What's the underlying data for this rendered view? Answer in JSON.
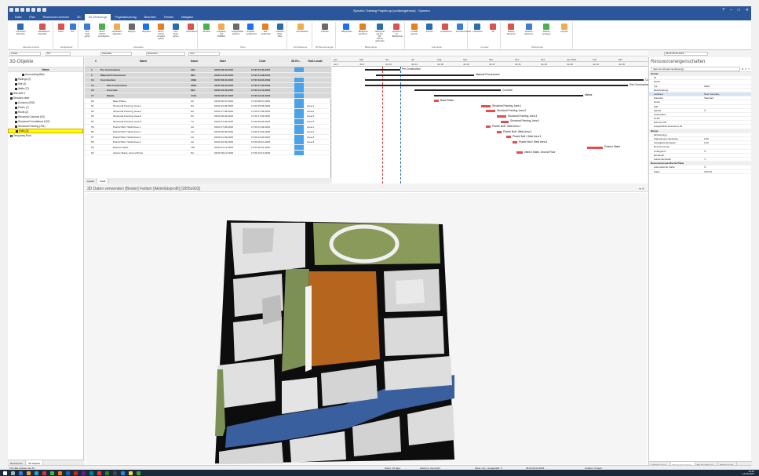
{
  "window": {
    "title": "Synchro Training Projekt.sp (vorübergehend) - Synchro"
  },
  "ribbon_tabs": [
    "Datei",
    "Plan",
    "Ressourcen-Inventur",
    "3D",
    "3D-Werkzeuge",
    "Projektsteuerung",
    "Berichten",
    "Fenster",
    "Navigator"
  ],
  "active_tab_index": 4,
  "ribbon_groups": [
    {
      "label": "Aktuelle Ansicht",
      "buttons": [
        "Fokussiert absenden",
        "Aktualisieren absenden"
      ]
    },
    {
      "label": "Sichtbarkeit",
      "buttons": [
        "100%",
        "Rot"
      ]
    },
    {
      "label": "Abspielen",
      "buttons": [
        "Zum Start gehen",
        "Einen Schritt zurückgehen",
        "Rückwärts abspielen",
        "Stoppen",
        "Abspielen",
        "Einen Schritt vorwärts gehen",
        "Zum Ende gehen",
        "Automatisch"
      ]
    },
    {
      "label": "Filter",
      "buttons": [
        "3D-Filter",
        "Aufgaben und Pfadfilter",
        "Ausgewählte isolieren",
        "Auswahl ausblenden",
        "Alle einblenden",
        "Inklusive Pfad-Filter"
      ]
    },
    {
      "label": "Schnittebene",
      "buttons": [
        "Schnittebene"
      ]
    },
    {
      "label": "3D Bemerkungen",
      "buttons": [
        "Fußnote"
      ]
    },
    {
      "label": "Blickpunkte",
      "buttons": [
        "Blickpunkte",
        "Blickpunkt speichern",
        "Blickpunkt auf den 3D-Schnitt gebunden",
        "Speichern mit Blickpunkte"
      ]
    },
    {
      "label": "Animation",
      "buttons": [
        "Ins Bild gesetzt",
        "Fronten",
        "Animationen",
        "Animationsstrahl"
      ]
    },
    {
      "label": "Fenster",
      "buttons": [
        "Fokussiert",
        "3D"
      ]
    },
    {
      "label": "Werkzeuge",
      "buttons": [
        "Markup aktivieren",
        "Ansehen aktivieren",
        "Dateien anzeigen",
        "Layouts"
      ]
    }
  ],
  "filterbar": {
    "field1": "Install",
    "field2": "5%",
    "field3": "Standard",
    "field4": "Resource",
    "field5": "Text",
    "date": "09:00 06.04.2015"
  },
  "left_panel": {
    "title": "3D-Objekte",
    "column": "Name",
    "items": [
      {
        "label": "Surrounding Bldn",
        "indent": 6,
        "checked": true,
        "selected": false
      },
      {
        "label": "Railings (2)",
        "indent": 3,
        "checked": true,
        "selected": false
      },
      {
        "label": "Site (4)",
        "indent": 3,
        "checked": true,
        "selected": false
      },
      {
        "label": "Walls (17)",
        "indent": 3,
        "checked": true,
        "selected": false
      },
      {
        "label": "Site.dwfx 1",
        "indent": 1,
        "checked": true,
        "selected": false
      },
      {
        "label": "Structure.dwfx",
        "indent": 1,
        "checked": true,
        "selected": false
      },
      {
        "label": "Columns (208)",
        "indent": 3,
        "checked": true,
        "selected": false
      },
      {
        "label": "Floors (7)",
        "indent": 3,
        "checked": true,
        "selected": false
      },
      {
        "label": "Roofs (2)",
        "indent": 3,
        "checked": true,
        "selected": false
      },
      {
        "label": "Structural Columns (93)",
        "indent": 3,
        "checked": true,
        "selected": false
      },
      {
        "label": "Structural Foundations (102)",
        "indent": 3,
        "checked": true,
        "selected": false
      },
      {
        "label": "Structural Framing (781)",
        "indent": 3,
        "checked": true,
        "selected": false
      },
      {
        "label": "Walls (8)",
        "indent": 3,
        "checked": true,
        "selected": true
      },
      {
        "label": "Temporary Roof",
        "indent": 1,
        "checked": false,
        "selected": false
      }
    ],
    "bottom_tabs": [
      "Ressourcen",
      "3D-Objekte"
    ]
  },
  "task_table": {
    "headers": [
      "#",
      "Name",
      "Dauer",
      "Start",
      "Code",
      "3D Re...",
      "Task Locati"
    ],
    "rows": [
      {
        "num": "1",
        "name": "Pre Construction",
        "dur": "30d",
        "start": "09:00 06.04.2015",
        "code": "17:00 15.05.2015",
        "loc": "",
        "group": true,
        "level": 1,
        "blue": true
      },
      {
        "num": "6",
        "name": "Material Procurement",
        "dur": "96d",
        "start": "09:00 13.04.2015",
        "code": "17:00 14.08.2015",
        "loc": "",
        "group": true,
        "level": 1,
        "blue": false
      },
      {
        "num": "13",
        "name": "Construction",
        "dur": "236d",
        "start": "09:00 06.04.2015",
        "code": "17:00 02.03.2016",
        "loc": "",
        "group": true,
        "level": 1,
        "blue": true
      },
      {
        "num": "14",
        "name": "Site Construction",
        "dur": "226d",
        "start": "09:00 06.04.2015",
        "code": "17:00 17.02.2016",
        "loc": "",
        "group": true,
        "level": 2,
        "blue": true
      },
      {
        "num": "16",
        "name": "Concrete",
        "dur": "83d",
        "start": "09:00 23.06.2015",
        "code": "17:00 14.10.2015",
        "loc": "",
        "group": true,
        "level": 2,
        "blue": true
      },
      {
        "num": "17",
        "name": "Metals",
        "dur": "144d",
        "start": "09:00 06.07.2015",
        "code": "17:00 21.01.2016",
        "loc": "",
        "group": true,
        "level": 2,
        "blue": true
      },
      {
        "num": "50",
        "name": "Base Plates",
        "dur": "3d",
        "start": "09:00 06.07.2015",
        "code": "17:00 08.07.2015",
        "loc": "",
        "group": false,
        "level": 3,
        "blue": true
      },
      {
        "num": "51",
        "name": "Structural Framing, Area 1",
        "dur": "8d",
        "start": "09:00 16.08.2015",
        "code": "17:00 25.08.2015",
        "loc": "Area 1",
        "group": false,
        "level": 3,
        "blue": true
      },
      {
        "num": "52",
        "name": "Structural Framing, Area 2",
        "dur": "8d",
        "start": "09:00 27.08.2015",
        "code": "17:00 07.09.2015",
        "loc": "Area 2",
        "group": false,
        "level": 3,
        "blue": true
      },
      {
        "num": "53",
        "name": "Structural Framing, Area 3",
        "dur": "8d",
        "start": "09:00 08.09.2015",
        "code": "17:00 17.09.2015",
        "loc": "Area 3",
        "group": false,
        "level": 3,
        "blue": true
      },
      {
        "num": "54",
        "name": "Structural Framing, Area 4",
        "dur": "7d",
        "start": "09:00 21.09.2015",
        "code": "17:00 29.09.2015",
        "loc": "Area 4",
        "group": false,
        "level": 3,
        "blue": true
      },
      {
        "num": "55",
        "name": "Plumb/ Bolt / Weld Area 1",
        "dur": "4d",
        "start": "09:00 27.08.2015",
        "code": "17:00 01.09.2015",
        "loc": "Area 1",
        "group": false,
        "level": 3,
        "blue": true
      },
      {
        "num": "56",
        "name": "Plumb/ Bolt / Weld Area 2",
        "dur": "4d",
        "start": "09:00 08.09.2015",
        "code": "17:00 14.09.2015",
        "loc": "Area 2",
        "group": false,
        "level": 3,
        "blue": true
      },
      {
        "num": "57",
        "name": "Plumb/ Bolt / Weld Area 3",
        "dur": "4d",
        "start": "09:00 21.09.2015",
        "code": "17:00 24.09.2015",
        "loc": "Area 3",
        "group": false,
        "level": 3,
        "blue": true
      },
      {
        "num": "58",
        "name": "Plumb/ Bolt / Weld Area 4",
        "dur": "4d",
        "start": "09:00 30.09.2015",
        "code": "17:00 05.10.2015",
        "loc": "Area 4",
        "group": false,
        "level": 3,
        "blue": true
      },
      {
        "num": "59",
        "name": "Exterior Stairs",
        "dur": "15d",
        "start": "09:00 21.12.2015",
        "code": "17:00 20.01.2016",
        "loc": "",
        "group": false,
        "level": 3,
        "blue": true
      },
      {
        "num": "60",
        "name": "Interior Stairs, Ground Floor",
        "dur": "5d",
        "start": "09:00 09.10.2015",
        "code": "17:00 15.10.2015",
        "loc": "",
        "group": false,
        "level": 3,
        "blue": true
      }
    ],
    "bottom_tabs": [
      "Layout",
      "Gantt"
    ]
  },
  "gantt": {
    "months": [
      "Apr",
      "Mai",
      "Jun",
      "Jul",
      "Aug",
      "Sep",
      "Okt",
      "Nov",
      "Dez",
      "Jan 2016",
      "Feb",
      "Mrz"
    ],
    "weeks": [
      "Jw 1",
      "Jw 5",
      "Jw 10",
      "Jw 14",
      "Jw 18",
      "Jw 23",
      "Jw 27",
      "Jw 31",
      "Jw 36",
      "Jw 40",
      "Jw 44",
      "Jw 49"
    ],
    "labels": {
      "pre": "Pre Construction",
      "material": "Material Procurement",
      "construction": "Construction",
      "site": "Site Construction",
      "concrete": "Concrete",
      "metals": "Metals",
      "base": "Base Plates",
      "sf1": "Structural Framing, Area 1",
      "sf2": "Structural Framing, Area 2",
      "sf3": "Structural Framing, Area 3",
      "sf4": "Structural Framing, Area 4",
      "pb1": "Plumb/ Bolt / Weld Area 1",
      "pb2": "Plumb/ Bolt / Weld Area 2",
      "pb3": "Plumb/ Bolt / Weld Area 3",
      "pb4": "Plumb/ Bolt / Weld Area 4",
      "ext": "Exterior Stairs",
      "int": "Interior Stairs, Ground Floor"
    }
  },
  "view3d": {
    "title": "3D Daten verwenden [Bester] Farben [Aktivitätsprofil] [1895x903]"
  },
  "properties": {
    "title": "Ressourceneigenschaften",
    "toolbar_label": "Sammel (Zusammenfassung)",
    "rows": [
      {
        "k": "Global",
        "v": "",
        "cat": true
      },
      {
        "k": "ID",
        "v": "",
        "cat": false
      },
      {
        "k": "Name",
        "v": "",
        "cat": false
      },
      {
        "k": "Typ",
        "v": "Walls",
        "cat": false
      },
      {
        "k": "Beschreibung",
        "v": "",
        "cat": false
      },
      {
        "k": "Lieferant",
        "v": "New Company",
        "cat": false,
        "hl": true
      },
      {
        "k": "Kalender",
        "v": "Standard",
        "cat": false
      },
      {
        "k": "Email",
        "v": "",
        "cat": false
      },
      {
        "k": "URL",
        "v": "",
        "cat": false
      },
      {
        "k": "Aktuell",
        "v": "☑",
        "cat": false
      },
      {
        "k": "Lieferstatus",
        "v": "",
        "cat": false
      },
      {
        "k": "GUID",
        "v": "",
        "cat": false
      },
      {
        "k": "Externe UID",
        "v": "",
        "cat": false
      },
      {
        "k": "Ausgewählte Ressource ID",
        "v": "",
        "cat": false
      },
      {
        "k": "Menge",
        "v": "",
        "cat": true
      },
      {
        "k": "Einheitentyp",
        "v": "",
        "cat": false
      },
      {
        "k": "Zugewiesene Einheiten",
        "v": "0.00",
        "cat": false
      },
      {
        "k": "Verfügbare Einheiten",
        "v": "1.00",
        "cat": false
      },
      {
        "k": "Ressourcentyp",
        "v": "",
        "cat": false
      },
      {
        "k": "Unbegrenzt",
        "v": "☑",
        "cat": false
      },
      {
        "k": "Einsatzart",
        "v": "",
        "cat": false
      },
      {
        "k": "Ganze Einheiten",
        "v": "☐",
        "cat": false
      },
      {
        "k": "Ressourcenspezifische Pläne",
        "v": "",
        "cat": true
      },
      {
        "k": "Automatische Farbe",
        "v": "☑",
        "cat": false
      },
      {
        "k": "Farbe",
        "v": "0.00.00",
        "cat": false
      }
    ],
    "bottom_tabs": [
      "Aufgabeneigen...",
      "Ressourceneigen...",
      "3D-Ansichtseige...",
      "3D Eigensch..."
    ]
  },
  "statusbar": {
    "left": "Für Hilfe drücken Sie F1",
    "items": [
      "Daten: 46 days",
      "Zeitzone: Gemischt",
      "[Filter zur] - ausgewählt: 5",
      "09:00 06.04.2015",
      "Position: Projekt"
    ]
  },
  "taskbar": {
    "time": "12:41",
    "date": "14.06.2017"
  },
  "colors": {
    "titlebar": "#2b579a",
    "accent": "#4aa3e8",
    "gantt_bar": "#e34d4d",
    "building": "#d8d8d8",
    "road": "#0d0d0d",
    "river": "#3a5f9e",
    "construction": "#b5651d",
    "grass": "#8a9a5b"
  }
}
